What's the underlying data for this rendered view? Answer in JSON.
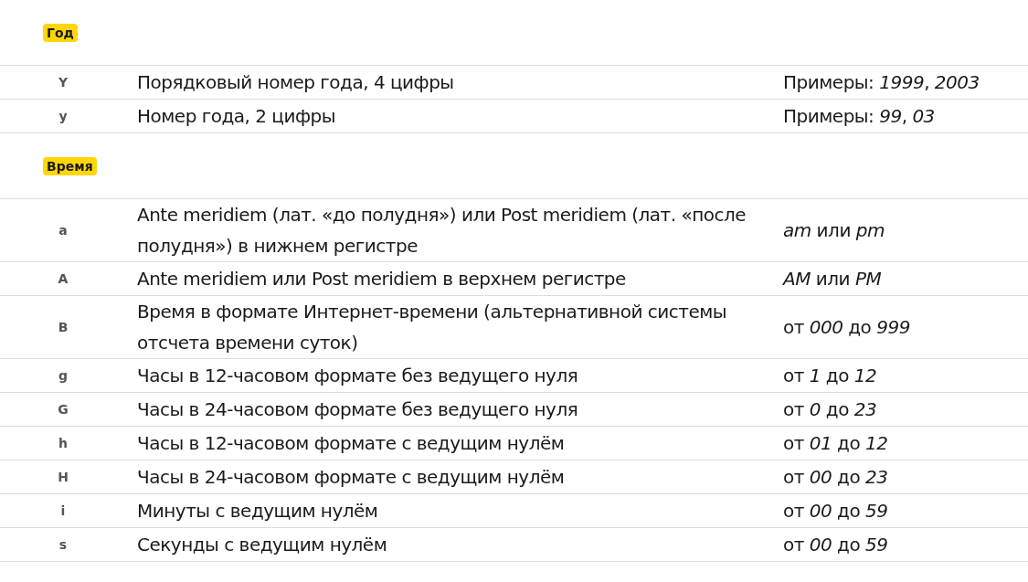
{
  "sections": [
    {
      "title": "Год",
      "rows": [
        {
          "key": "Y",
          "description": "Порядковый номер года, 4 цифры",
          "example": "Примеры: *1999*, *2003*"
        },
        {
          "key": "y",
          "description": "Номер года, 2 цифры",
          "example": "Примеры: *99*, *03*"
        }
      ]
    },
    {
      "title": "Время",
      "rows": [
        {
          "key": "a",
          "description": "Ante meridiem (лат. «до полудня») или Post meridiem (лат. «после полудня») в нижнем регистре",
          "example": "*am* или *pm*"
        },
        {
          "key": "A",
          "description": "Ante meridiem или Post meridiem в верхнем регистре",
          "example": "*AM* или *PM*"
        },
        {
          "key": "B",
          "description": "Время в формате Интернет-времени (альтернативной системы отсчета времени суток)",
          "example": "от *000* до *999*"
        },
        {
          "key": "g",
          "description": "Часы в 12-часовом формате без ведущего нуля",
          "example": "от *1* до *12*"
        },
        {
          "key": "G",
          "description": "Часы в 24-часовом формате без ведущего нуля",
          "example": "от *0* до *23*"
        },
        {
          "key": "h",
          "description": "Часы в 12-часовом формате с ведущим нулём",
          "example": "от *01* до *12*"
        },
        {
          "key": "H",
          "description": "Часы в 24-часовом формате с ведущим нулём",
          "example": "от *00* до *23*"
        },
        {
          "key": "i",
          "description": "Минуты с ведущим нулём",
          "example": "от *00* до *59*"
        },
        {
          "key": "s",
          "description": "Секунды с ведущим нулём",
          "example": "от *00* до *59*"
        }
      ]
    }
  ]
}
